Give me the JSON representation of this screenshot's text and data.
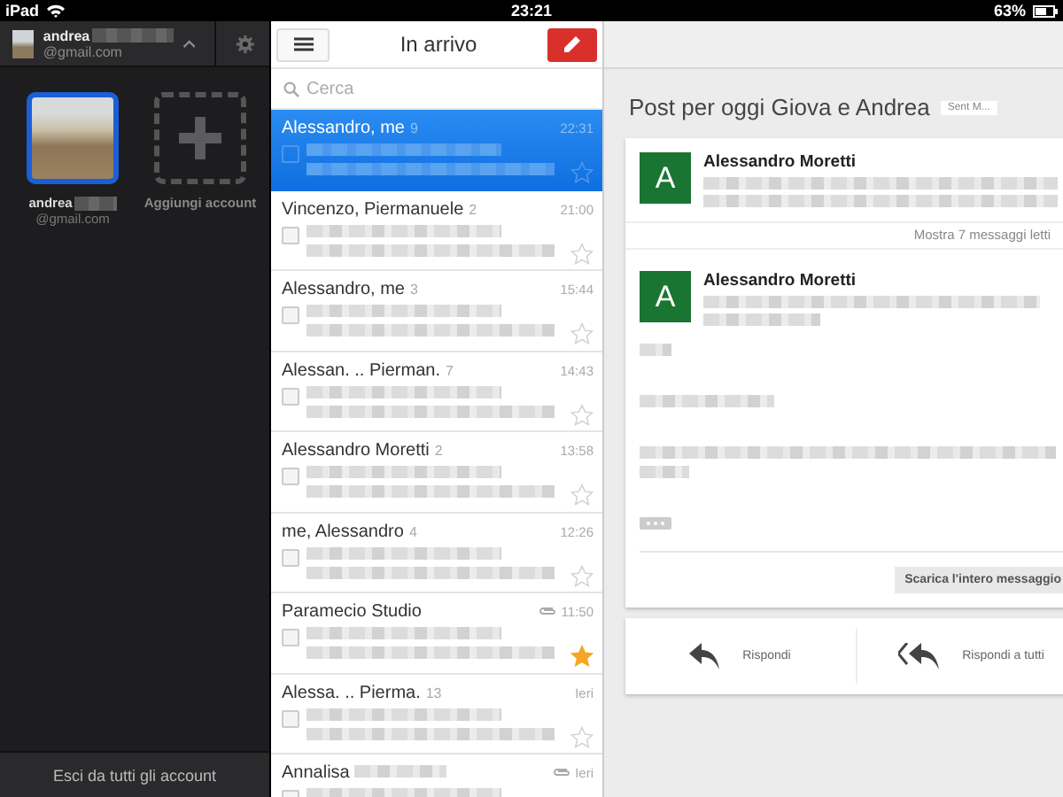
{
  "status_bar": {
    "device": "iPad",
    "time": "23:21",
    "battery": "63%"
  },
  "accounts_panel": {
    "current": {
      "name": "andrea",
      "email": "@gmail.com"
    },
    "accounts": [
      {
        "name": "andrea",
        "email": "@gmail.com",
        "selected": true
      }
    ],
    "add_account": "Aggiungi account",
    "sign_out": "Esci da tutti gli account"
  },
  "inbox": {
    "title": "In arrivo",
    "search": {
      "placeholder": "Cerca"
    },
    "threads": [
      {
        "sender": "Alessandro, me",
        "count": "9",
        "time": "22:31",
        "selected": true,
        "starred": false,
        "attachment": false
      },
      {
        "sender": "Vincenzo, Piermanuele",
        "count": "2",
        "time": "21:00",
        "selected": false,
        "starred": false,
        "attachment": false
      },
      {
        "sender": "Alessandro, me",
        "count": "3",
        "time": "15:44",
        "selected": false,
        "starred": false,
        "attachment": false
      },
      {
        "sender": "Alessan. .. Pierman.",
        "count": "7",
        "time": "14:43",
        "selected": false,
        "starred": false,
        "attachment": false
      },
      {
        "sender": "Alessandro Moretti",
        "count": "2",
        "time": "13:58",
        "selected": false,
        "starred": false,
        "attachment": false
      },
      {
        "sender": "me, Alessandro",
        "count": "4",
        "time": "12:26",
        "selected": false,
        "starred": false,
        "attachment": false
      },
      {
        "sender": "Paramecio Studio",
        "time": "11:50",
        "selected": false,
        "starred": true,
        "attachment": true
      },
      {
        "sender": "Alessa. .. Pierma.",
        "count": "13",
        "time": "Ieri",
        "selected": false,
        "starred": false,
        "attachment": false
      },
      {
        "sender": "Annalisa",
        "time": "Ieri",
        "selected": false,
        "attachment": true
      }
    ]
  },
  "conversation": {
    "subject": "Post per oggi Giova e Andrea",
    "label": "Sent M...",
    "messages": [
      {
        "avatar": "A",
        "sender": "Alessandro Moretti"
      },
      {
        "avatar": "A",
        "sender": "Alessandro Moretti"
      }
    ],
    "collapsed": "Mostra 7 messaggi letti",
    "download_button": "Scarica l'intero messaggio",
    "actions": [
      {
        "kind": "reply",
        "label": "Rispondi"
      },
      {
        "kind": "reply-all",
        "label": "Rispondi a tutti"
      }
    ]
  }
}
